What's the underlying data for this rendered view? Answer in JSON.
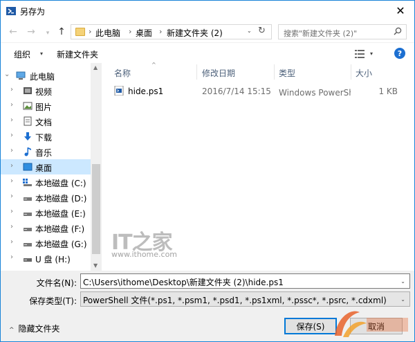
{
  "window": {
    "title": "另存为",
    "close_glyph": "✕"
  },
  "nav": {
    "back_glyph": "←",
    "forward_glyph": "→",
    "recent_glyph": "▾",
    "up_glyph": "↑",
    "breadcrumb": [
      "此电脑",
      "桌面",
      "新建文件夹 (2)"
    ],
    "separator": "›",
    "dropdown_glyph": "⌄",
    "refresh_glyph": "↻",
    "search_placeholder": "搜索\"新建文件夹 (2)\""
  },
  "toolbar": {
    "organize_label": "组织",
    "caret": "▾",
    "new_folder_label": "新建文件夹",
    "help_glyph": "?"
  },
  "sidebar": {
    "items": [
      {
        "label": "此电脑",
        "icon": "computer-icon",
        "level": 0,
        "selected": false
      },
      {
        "label": "视频",
        "icon": "video-icon",
        "level": 1,
        "selected": false
      },
      {
        "label": "图片",
        "icon": "pictures-icon",
        "level": 1,
        "selected": false
      },
      {
        "label": "文档",
        "icon": "documents-icon",
        "level": 1,
        "selected": false
      },
      {
        "label": "下载",
        "icon": "download-icon",
        "level": 1,
        "selected": false
      },
      {
        "label": "音乐",
        "icon": "music-icon",
        "level": 1,
        "selected": false
      },
      {
        "label": "桌面",
        "icon": "desktop-icon",
        "level": 1,
        "selected": true
      },
      {
        "label": "本地磁盘 (C:)",
        "icon": "system-drive-icon",
        "level": 1,
        "selected": false
      },
      {
        "label": "本地磁盘 (D:)",
        "icon": "drive-icon",
        "level": 1,
        "selected": false
      },
      {
        "label": "本地磁盘 (E:)",
        "icon": "drive-icon",
        "level": 1,
        "selected": false
      },
      {
        "label": "本地磁盘 (F:)",
        "icon": "drive-icon",
        "level": 1,
        "selected": false
      },
      {
        "label": "本地磁盘 (G:)",
        "icon": "drive-icon",
        "level": 1,
        "selected": false
      },
      {
        "label": "U 盘 (H:)",
        "icon": "usb-drive-icon",
        "level": 1,
        "selected": false
      }
    ],
    "expand_glyph": "›",
    "collapse_glyph": "⌄"
  },
  "file_list": {
    "columns": {
      "name": "名称",
      "date": "修改日期",
      "type": "类型",
      "size": "大小"
    },
    "sort_glyph": "^",
    "rows": [
      {
        "name": "hide.ps1",
        "date": "2016/7/14 15:15",
        "type": "Windows PowerShell 脚本",
        "size": "1 KB"
      }
    ]
  },
  "watermark": {
    "logo": "IT之家",
    "url": "www.ithome.com"
  },
  "form": {
    "filename_label": "文件名(N):",
    "filename_value": "C:\\Users\\ithome\\Desktop\\新建文件夹 (2)\\hide.ps1",
    "filetype_label": "保存类型(T):",
    "filetype_value": "PowerShell 文件(*.ps1, *.psm1, *.psd1, *.ps1xml, *.pssc*, *.psrc, *.cdxml)",
    "field_caret": "⌄"
  },
  "footer": {
    "hide_folders_label": "隐藏文件夹",
    "hide_caret": "^",
    "save_label": "保存(S)",
    "cancel_label": "取消"
  },
  "colors": {
    "accent": "#0078d7",
    "selection": "#cce8ff",
    "header_text": "#4c607a"
  }
}
